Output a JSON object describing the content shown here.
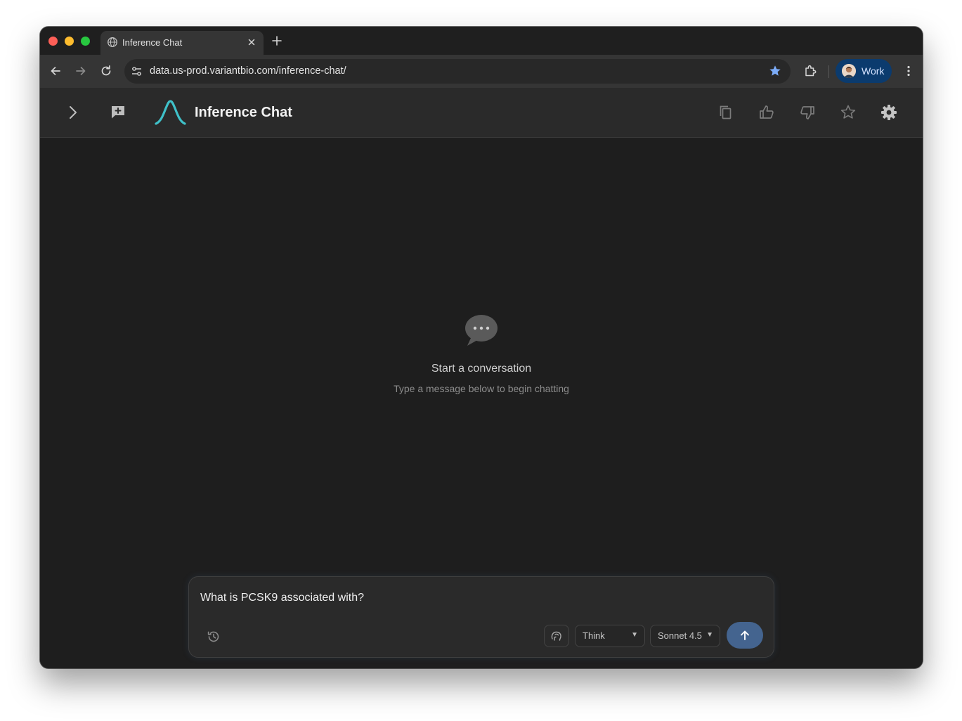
{
  "browser": {
    "tab": {
      "title": "Inference Chat",
      "icon": "globe-icon"
    },
    "omnibox": {
      "url": "data.us-prod.variantbio.com/inference-chat/",
      "bookmarked": true
    },
    "profile": {
      "label": "Work"
    },
    "colors": {
      "profile_bg": "#0b3b6e",
      "bookmark_star": "#7cacf8"
    }
  },
  "app": {
    "title": "Inference Chat",
    "colors": {
      "logo_accent": "#3fc1c9",
      "send_button": "#44648f"
    }
  },
  "empty_state": {
    "title": "Start a conversation",
    "subtitle": "Type a message below to begin chatting"
  },
  "composer": {
    "input_value": "What is PCSK9 associated with?",
    "think_select": {
      "value": "Think"
    },
    "model_select": {
      "value": "Sonnet 4.5"
    }
  }
}
